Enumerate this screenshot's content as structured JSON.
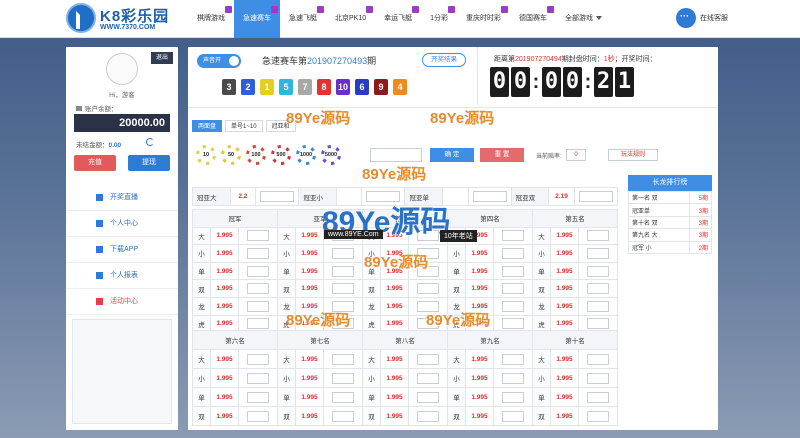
{
  "brand": {
    "name": "K8彩乐园",
    "site": "WWW.7370.COM"
  },
  "nav": [
    {
      "label": "棋牌游戏",
      "hot": true
    },
    {
      "label": "急速赛车",
      "hot": true,
      "active": true
    },
    {
      "label": "急速飞艇",
      "hot": true
    },
    {
      "label": "北京PK10",
      "hot": true
    },
    {
      "label": "幸运飞艇",
      "hot": true
    },
    {
      "label": "1分彩",
      "hot": true
    },
    {
      "label": "重庆时时彩",
      "hot": true
    },
    {
      "label": "德国赛车",
      "hot": true
    },
    {
      "label": "全部游戏",
      "dropdown": true
    }
  ],
  "service_label": "在线客服",
  "account": {
    "logout": "退出",
    "greeting": "Hi，游客",
    "balance_label": "账户余额：",
    "balance": "20000.00",
    "unsettled_label": "未结金额：",
    "unsettled": "0.00",
    "deposit": "充值",
    "withdraw": "提现"
  },
  "menu": [
    {
      "label": "开奖直播",
      "icon": "monitor-icon"
    },
    {
      "label": "个人中心",
      "icon": "user-icon"
    },
    {
      "label": "下载APP",
      "icon": "download-icon"
    },
    {
      "label": "个人报表",
      "icon": "report-icon"
    },
    {
      "label": "活动中心",
      "icon": "gift-icon"
    }
  ],
  "game": {
    "sound_toggle": "声音开",
    "title_prefix": "急速赛车第",
    "period": "201907270493",
    "title_suffix": "期",
    "results_button": "开奖结果",
    "balls": [
      {
        "n": "3",
        "color": "#4a4a4a"
      },
      {
        "n": "2",
        "color": "#2e5fd6"
      },
      {
        "n": "1",
        "color": "#e3cf1e"
      },
      {
        "n": "5",
        "color": "#2fb5e0"
      },
      {
        "n": "7",
        "color": "#a8a8a8"
      },
      {
        "n": "8",
        "color": "#e33232"
      },
      {
        "n": "10",
        "color": "#6b2fc9"
      },
      {
        "n": "6",
        "color": "#2a3cc2"
      },
      {
        "n": "9",
        "color": "#8c1c1c"
      },
      {
        "n": "4",
        "color": "#f08a1d"
      }
    ],
    "next_prefix": "距离第",
    "next_period": "201907270494",
    "next_mid": "期封盘时间：",
    "close_time": "1秒",
    "next_end": "；开奖时间：",
    "countdown": [
      "0",
      "0",
      "0",
      "0",
      "2",
      "1"
    ]
  },
  "tabs": [
    "两面盘",
    "单号1~10",
    "冠亚和"
  ],
  "chips": [
    {
      "v": "10",
      "c": "#d9d24a"
    },
    {
      "v": "50",
      "c": "#e8c23a"
    },
    {
      "v": "100",
      "c": "#d24a3a"
    },
    {
      "v": "500",
      "c": "#c83a3a"
    },
    {
      "v": "1000",
      "c": "#3a8ad2"
    },
    {
      "v": "5000",
      "c": "#6b4ac8"
    }
  ],
  "bet": {
    "confirm": "确 定",
    "reset": "重 置",
    "current_label": "当前赔率:",
    "current_value": "0",
    "rules": "玩法规则"
  },
  "sum_row": [
    {
      "label": "冠亚大",
      "odd": "2.2"
    },
    {
      "label": "冠亚小",
      "odd": ""
    },
    {
      "label": "冠亚单",
      "odd": ""
    },
    {
      "label": "冠亚双",
      "odd": "2.19"
    }
  ],
  "positions_top": [
    "冠军",
    "亚军",
    "第三名",
    "第四名",
    "第五名"
  ],
  "rows_top": [
    "大",
    "小",
    "单",
    "双",
    "龙",
    "虎"
  ],
  "positions_bottom": [
    "第六名",
    "第七名",
    "第八名",
    "第九名",
    "第十名"
  ],
  "rows_bottom": [
    "大",
    "小",
    "单",
    "双"
  ],
  "odd": "1.995",
  "dragon": {
    "title": "长龙排行榜",
    "rows": [
      {
        "name": "第一名 双",
        "period": "5期"
      },
      {
        "name": "冠亚单",
        "period": "3期"
      },
      {
        "name": "第十名 双",
        "period": "3期"
      },
      {
        "name": "第九名 大",
        "period": "3期"
      },
      {
        "name": "冠军 小",
        "period": "2期"
      }
    ]
  },
  "watermark": {
    "text": "89Ye源码",
    "url": "www.89YE.Com",
    "tag": "10年老站"
  }
}
